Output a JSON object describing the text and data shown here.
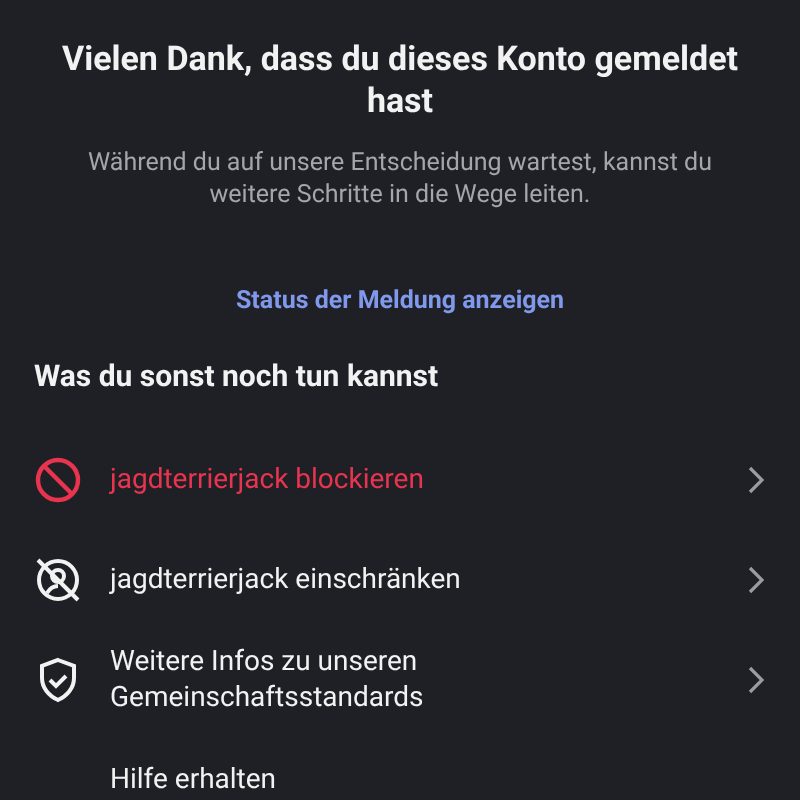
{
  "title": "Vielen Dank, dass du dieses Konto gemeldet hast",
  "subtitle": "Während du auf unsere Entscheidung wartest, kannst du weitere Schritte in die Wege leiten.",
  "status_link": "Status der Meldung anzeigen",
  "section_heading": "Was du sonst noch tun kannst",
  "actions": [
    {
      "kind": "block",
      "label": "jagdterrierjack blockieren",
      "chevron": true
    },
    {
      "kind": "restrict",
      "label": "jagdterrierjack einschränken",
      "chevron": true
    },
    {
      "kind": "info",
      "label": "Weitere Infos zu unseren Gemeinschaftsstandards",
      "chevron": true
    },
    {
      "kind": "help",
      "label": "Hilfe erhalten",
      "chevron": false
    }
  ]
}
